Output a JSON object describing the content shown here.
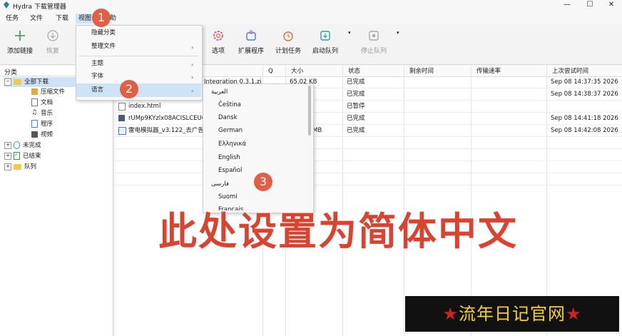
{
  "window": {
    "title": "Hydra 下载管理器",
    "minimize": "—",
    "maximize": "☐",
    "close": "✕"
  },
  "menubar": [
    "任务",
    "文件",
    "下载",
    "视图",
    "帮助"
  ],
  "toolbar": {
    "add": "添加链接",
    "resume": "恢复",
    "options": "选项",
    "extensions": "扩展程序",
    "scheduler": "计划任务",
    "start_queue": "启动队列",
    "stop_queue": "停止队列"
  },
  "tree": {
    "header": "分类",
    "all": "全部下载",
    "children": [
      "压缩文件",
      "文档",
      "音乐",
      "程序",
      "视频"
    ],
    "incomplete": "未完成",
    "finished": "已结束",
    "queue": "队列"
  },
  "table": {
    "headers": {
      "name": "",
      "q": "Q",
      "size": "大小",
      "status": "状态",
      "remaining": "剩余时间",
      "speed": "传输速率",
      "last": "上次尝试时间"
    },
    "rows": [
      {
        "name": "Integration 0.3.1.zip",
        "size": "65.02 KB",
        "status": "已完成",
        "remaining": "",
        "speed": "",
        "last": "Sep 08 14:37:35 2026"
      },
      {
        "name": "",
        "size": "3",
        "status": "已完成",
        "remaining": "",
        "speed": "",
        "last": "Sep 08 14:38:37 2026"
      },
      {
        "name": "index.html",
        "size": "",
        "status": "已暂停",
        "remaining": "",
        "speed": "",
        "last": ""
      },
      {
        "name": "rUMp9KYzlx08ACISLCEU0",
        "size": "",
        "status": "已完成",
        "remaining": "",
        "speed": "",
        "last": "Sep 08 14:41:18 2026"
      },
      {
        "name": "雷电模拟器_v3.122_去广告",
        "size": "MB",
        "status": "已完成",
        "remaining": "",
        "speed": "",
        "last": "Sep 08 14:42:08 2026"
      }
    ]
  },
  "view_menu": {
    "items": [
      "隐藏分类",
      "整理文件",
      "主题",
      "字体",
      "语言"
    ]
  },
  "language_menu": {
    "items": [
      "العربية",
      "Čeština",
      "Dansk",
      "German",
      "Ελληνικά",
      "English",
      "Español",
      "فارسی",
      "Suomi",
      "Français"
    ]
  },
  "badges": [
    "1",
    "2",
    "3"
  ],
  "overlay_text": "此处设置为简体中文",
  "banner": {
    "star": "★",
    "text": "流年日记官网"
  },
  "colors": {
    "accent_badge": "#e15f45",
    "overlay_red": "#d9432f",
    "banner_text": "#f7d21b",
    "menu_highlight": "#cfe3f7"
  }
}
